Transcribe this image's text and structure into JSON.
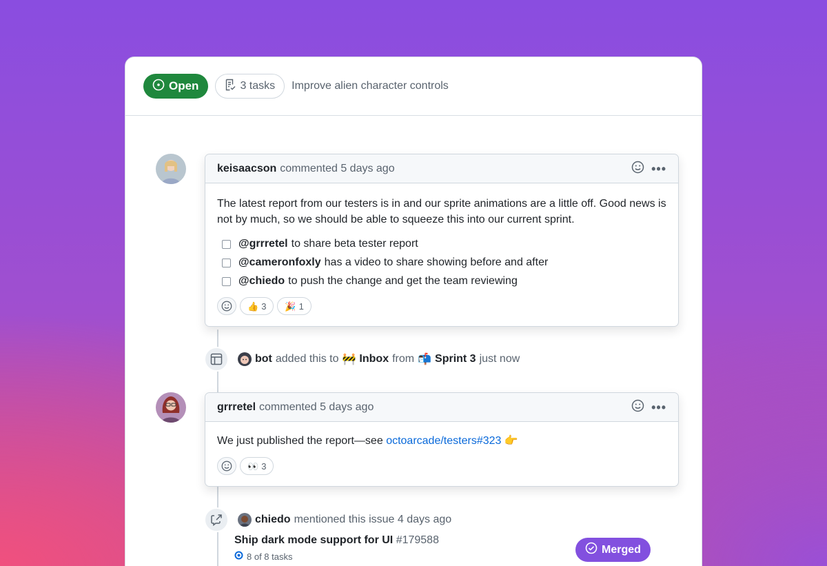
{
  "header": {
    "state_label": "Open",
    "tasks_label": "3 tasks",
    "issue_title": "Improve alien character controls"
  },
  "comments": [
    {
      "author": "keisaacson",
      "meta": "commented 5 days ago",
      "body": "The latest report from our testers is in and our sprite animations are a little off. Good news is not by much, so we should be able to squeeze this into our current sprint.",
      "tasks": [
        {
          "mention": "@grrretel",
          "text": "to share beta tester report"
        },
        {
          "mention": "@cameronfoxly",
          "text": "has a video to share showing before and after"
        },
        {
          "mention": "@chiedo",
          "text": "to push the change and get the team reviewing"
        }
      ],
      "reactions": [
        {
          "emoji": "👍",
          "count": "3"
        },
        {
          "emoji": "🎉",
          "count": "1"
        }
      ]
    },
    {
      "author": "grrretel",
      "meta": "commented 5 days ago",
      "body_prefix": "We just published the report—see",
      "link_text": "octoarcade/testers#323",
      "body_suffix": "👉",
      "reactions": [
        {
          "emoji": "👀",
          "count": "3"
        }
      ]
    }
  ],
  "project_event": {
    "actor": "bot",
    "text_added": "added this to",
    "inbox_emoji": "🚧",
    "inbox_label": "Inbox",
    "text_from": "from",
    "sprint_emoji": "📬",
    "sprint_label": "Sprint 3",
    "time": "just now"
  },
  "mention_event": {
    "actor": "chiedo",
    "text": "mentioned this issue 4 days ago",
    "ref_title": "Ship dark mode support for UI",
    "ref_number": "#179588",
    "ref_tasks": "8 of 8 tasks",
    "ref_state": "Merged"
  },
  "colors": {
    "open": "#1f883d",
    "merged": "#8250df",
    "link": "#0969da"
  }
}
